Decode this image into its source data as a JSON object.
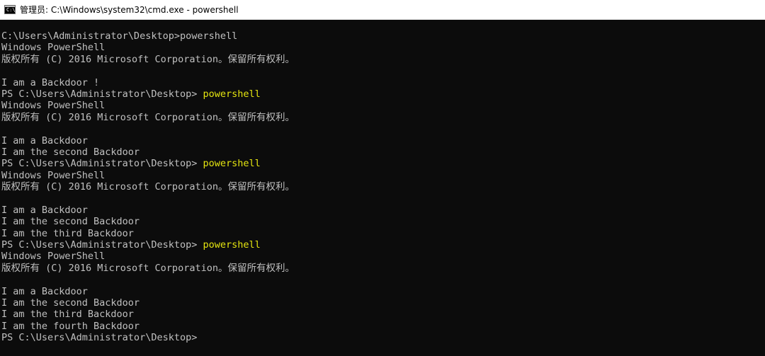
{
  "window": {
    "icon_glyph": "C:\\",
    "title": "管理员: C:\\Windows\\system32\\cmd.exe - powershell"
  },
  "console": {
    "lines": [
      {
        "text": "C:\\Users\\Administrator\\Desktop>powershell"
      },
      {
        "text": "Windows PowerShell"
      },
      {
        "text": "版权所有 (C) 2016 Microsoft Corporation。保留所有权利。"
      },
      {
        "text": ""
      },
      {
        "text": "I am a Backdoor !"
      },
      {
        "prompt": "PS C:\\Users\\Administrator\\Desktop> ",
        "command": "powershell"
      },
      {
        "text": "Windows PowerShell"
      },
      {
        "text": "版权所有 (C) 2016 Microsoft Corporation。保留所有权利。"
      },
      {
        "text": ""
      },
      {
        "text": "I am a Backdoor"
      },
      {
        "text": "I am the second Backdoor"
      },
      {
        "prompt": "PS C:\\Users\\Administrator\\Desktop> ",
        "command": "powershell"
      },
      {
        "text": "Windows PowerShell"
      },
      {
        "text": "版权所有 (C) 2016 Microsoft Corporation。保留所有权利。"
      },
      {
        "text": ""
      },
      {
        "text": "I am a Backdoor"
      },
      {
        "text": "I am the second Backdoor"
      },
      {
        "text": "I am the third Backdoor"
      },
      {
        "prompt": "PS C:\\Users\\Administrator\\Desktop> ",
        "command": "powershell"
      },
      {
        "text": "Windows PowerShell"
      },
      {
        "text": "版权所有 (C) 2016 Microsoft Corporation。保留所有权利。"
      },
      {
        "text": ""
      },
      {
        "text": "I am a Backdoor"
      },
      {
        "text": "I am the second Backdoor"
      },
      {
        "text": "I am the third Backdoor"
      },
      {
        "text": "I am the fourth Backdoor"
      },
      {
        "text": "PS C:\\Users\\Administrator\\Desktop>"
      }
    ]
  },
  "colors": {
    "console_background": "#0c0c0c",
    "console_text": "#c0c0c0",
    "command_text": "#e5e510",
    "titlebar_background": "#ffffff"
  }
}
